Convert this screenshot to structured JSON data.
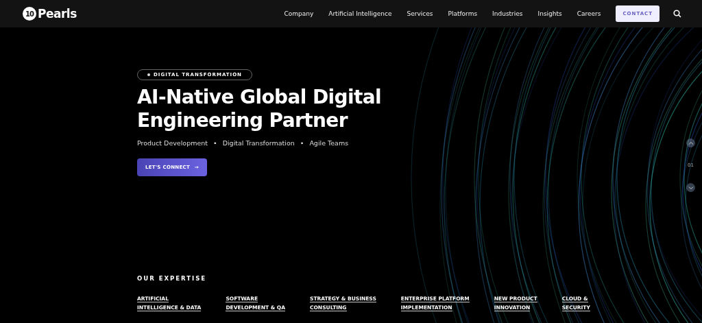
{
  "header": {
    "logo": "Pearls",
    "logo_mark": "10",
    "nav": [
      "Company",
      "Artificial Intelligence",
      "Services",
      "Platforms",
      "Industries",
      "Insights",
      "Careers"
    ],
    "contact": "CONTACT"
  },
  "hero": {
    "badge": "DIGITAL TRANSFORMATION",
    "title_lines": [
      "AI-Native Global Digital",
      "Engineering Partner"
    ],
    "tags": [
      "Product Development",
      "Digital Transformation",
      "Agile Teams"
    ],
    "separator": "•",
    "cta": "LET'S CONNECT",
    "cta_arrow": "→"
  },
  "slider": {
    "index": "01"
  },
  "expertise": {
    "heading": "OUR EXPERTISE",
    "items": [
      {
        "lines": [
          "ARTIFICIAL",
          "INTELLIGENCE & DATA"
        ]
      },
      {
        "lines": [
          "SOFTWARE",
          "DEVELOPMENT & QA"
        ]
      },
      {
        "lines": [
          "STRATEGY & BUSINESS",
          "CONSULTING"
        ]
      },
      {
        "lines": [
          "ENTERPRISE PLATFORM",
          "IMPLEMENTATION"
        ]
      },
      {
        "lines": [
          "NEW PRODUCT",
          "INNOVATION"
        ]
      },
      {
        "lines": [
          "CLOUD &",
          "SECURITY"
        ]
      }
    ]
  }
}
